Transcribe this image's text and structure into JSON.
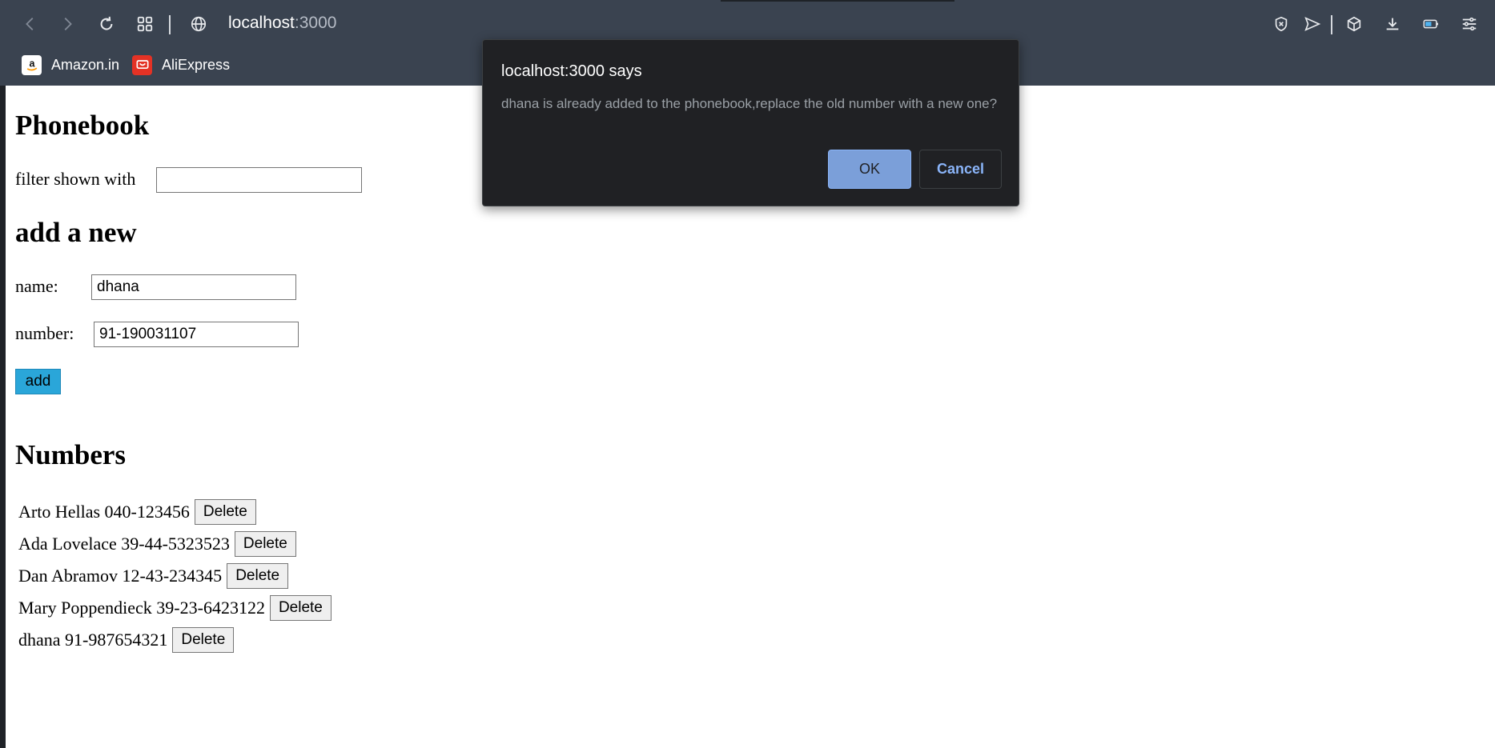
{
  "browser": {
    "url_host": "localhost",
    "url_port": ":3000",
    "bookmarks": [
      {
        "label": "Amazon.in",
        "icon": "amazon-icon",
        "color": "#ffffff"
      },
      {
        "label": "AliExpress",
        "icon": "aliexpress-icon",
        "color": "#e43225"
      }
    ]
  },
  "page": {
    "title": "Phonebook",
    "filter_label": "filter shown with",
    "filter_value": "",
    "add_heading": "add a new",
    "name_label": "name:",
    "name_value": "dhana",
    "number_label": "number:",
    "number_value": "91-190031107",
    "add_button": "add",
    "numbers_heading": "Numbers",
    "delete_label": "Delete",
    "persons": [
      {
        "entry": "Arto Hellas 040-123456"
      },
      {
        "entry": "Ada Lovelace 39-44-5323523"
      },
      {
        "entry": "Dan Abramov 12-43-234345"
      },
      {
        "entry": "Mary Poppendieck 39-23-6423122"
      },
      {
        "entry": "dhana 91-987654321"
      }
    ]
  },
  "dialog": {
    "title": "localhost:3000 says",
    "message": "dhana is already added to the phonebook,replace the old number with a new one?",
    "ok_label": "OK",
    "cancel_label": "Cancel"
  },
  "colors": {
    "chrome": "#3a4350",
    "add_button": "#2aa6d9",
    "dialog_bg": "#202124",
    "ok_button": "#7b9fd9"
  }
}
